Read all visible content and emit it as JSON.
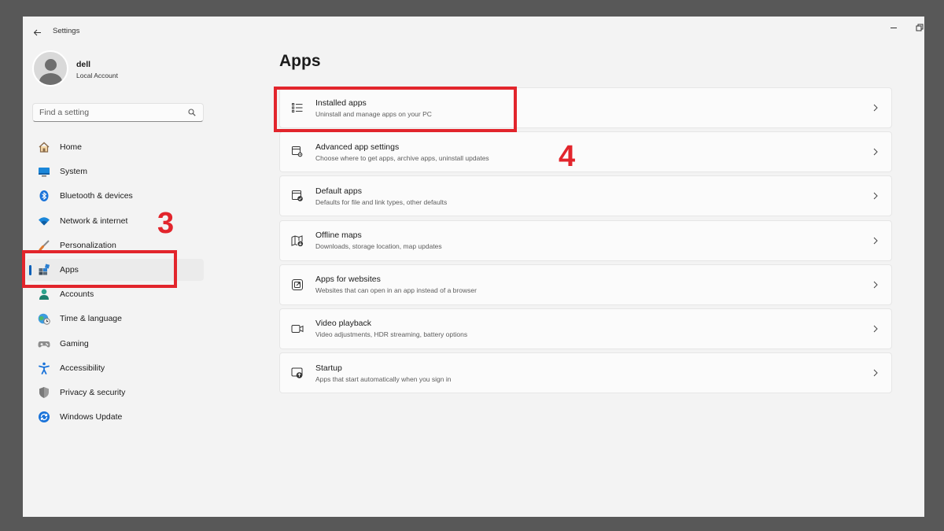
{
  "window": {
    "title": "Settings"
  },
  "account": {
    "name": "dell",
    "type": "Local Account"
  },
  "search": {
    "placeholder": "Find a setting",
    "value": ""
  },
  "sidebar": {
    "items": [
      {
        "label": "Home",
        "icon": "home-icon",
        "selected": false
      },
      {
        "label": "System",
        "icon": "system-icon",
        "selected": false
      },
      {
        "label": "Bluetooth & devices",
        "icon": "bluetooth-icon",
        "selected": false
      },
      {
        "label": "Network & internet",
        "icon": "wifi-icon",
        "selected": false
      },
      {
        "label": "Personalization",
        "icon": "brush-icon",
        "selected": false
      },
      {
        "label": "Apps",
        "icon": "apps-icon",
        "selected": true
      },
      {
        "label": "Accounts",
        "icon": "accounts-icon",
        "selected": false
      },
      {
        "label": "Time & language",
        "icon": "globe-clock-icon",
        "selected": false
      },
      {
        "label": "Gaming",
        "icon": "gamepad-icon",
        "selected": false
      },
      {
        "label": "Accessibility",
        "icon": "accessibility-icon",
        "selected": false
      },
      {
        "label": "Privacy & security",
        "icon": "shield-icon",
        "selected": false
      },
      {
        "label": "Windows Update",
        "icon": "update-icon",
        "selected": false
      }
    ]
  },
  "main": {
    "title": "Apps",
    "cards": [
      {
        "title": "Installed apps",
        "desc": "Uninstall and manage apps on your PC",
        "icon": "list-icon"
      },
      {
        "title": "Advanced app settings",
        "desc": "Choose where to get apps, archive apps, uninstall updates",
        "icon": "app-settings-icon"
      },
      {
        "title": "Default apps",
        "desc": "Defaults for file and link types, other defaults",
        "icon": "default-apps-icon"
      },
      {
        "title": "Offline maps",
        "desc": "Downloads, storage location, map updates",
        "icon": "map-icon"
      },
      {
        "title": "Apps for websites",
        "desc": "Websites that can open in an app instead of a browser",
        "icon": "open-external-icon"
      },
      {
        "title": "Video playback",
        "desc": "Video adjustments, HDR streaming, battery options",
        "icon": "video-icon"
      },
      {
        "title": "Startup",
        "desc": "Apps that start automatically when you sign in",
        "icon": "startup-icon"
      }
    ]
  },
  "annotations": {
    "step3": "3",
    "step4": "4",
    "color": "#e2252c"
  },
  "colors": {
    "accent": "#005fb8",
    "background": "#f3f3f3",
    "card": "#fbfbfb"
  }
}
